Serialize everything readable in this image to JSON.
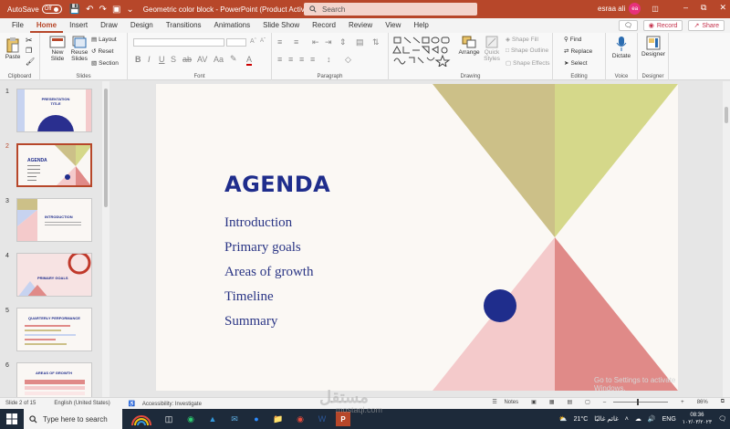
{
  "titlebar": {
    "autosave_label": "AutoSave",
    "autosave_state": "Off",
    "doc_title": "Geometric color block  -  PowerPoint (Product Activation Failed)",
    "search_placeholder": "Search",
    "user_name": "esraa ali",
    "user_initials": "ea"
  },
  "tabs": [
    "File",
    "Home",
    "Insert",
    "Draw",
    "Design",
    "Transitions",
    "Animations",
    "Slide Show",
    "Record",
    "Review",
    "View",
    "Help"
  ],
  "active_tab": "Home",
  "tab_actions": {
    "record": "Record",
    "share": "Share"
  },
  "ribbon": {
    "clipboard": {
      "paste": "Paste",
      "label": "Clipboard"
    },
    "slides": {
      "new_slide": "New Slide",
      "reuse": "Reuse Slides",
      "layout": "Layout",
      "reset": "Reset",
      "section": "Section",
      "label": "Slides"
    },
    "font": {
      "label": "Font"
    },
    "paragraph": {
      "label": "Paragraph"
    },
    "drawing": {
      "arrange": "Arrange",
      "quick_styles": "Quick Styles",
      "shape_fill": "Shape Fill",
      "shape_outline": "Shape Outline",
      "shape_effects": "Shape Effects",
      "label": "Drawing"
    },
    "editing": {
      "find": "Find",
      "replace": "Replace",
      "select": "Select",
      "label": "Editing"
    },
    "voice": {
      "dictate": "Dictate",
      "label": "Voice"
    },
    "designer": {
      "designer": "Designer",
      "label": "Designer"
    }
  },
  "thumbnails": [
    {
      "num": "1",
      "title": "PRESENTATION TITLE"
    },
    {
      "num": "2",
      "title": "AGENDA"
    },
    {
      "num": "3",
      "title": "INTRODUCTION"
    },
    {
      "num": "4",
      "title": "PRIMARY GOALS"
    },
    {
      "num": "5",
      "title": "QUARTERLY PERFORMANCE"
    },
    {
      "num": "6",
      "title": "AREAS OF GROWTH"
    }
  ],
  "slide": {
    "title": "AGENDA",
    "items": [
      "Introduction",
      "Primary goals",
      "Areas of growth",
      "Timeline",
      "Summary"
    ],
    "watermark": "Go to Settings to activate Windows.",
    "colors": {
      "olive": "#ccc088",
      "lime": "#d5d88a",
      "pink": "#f4cacb",
      "coral": "#e08a88",
      "navy": "#1f2d8c"
    }
  },
  "status": {
    "slide_info": "Slide 2 of 15",
    "language": "English (United States)",
    "accessibility": "Accessibility: Investigate",
    "notes": "Notes",
    "zoom": "86%"
  },
  "taskbar": {
    "search_placeholder": "Type here to search",
    "weather": "21°C",
    "weather_text": "غائم غالبًا",
    "lang": "ENG",
    "time": "08:36",
    "date": "١٠٢/٠٣/٢٠٢٣"
  },
  "watermark_logo": {
    "brand": "مستقل",
    "site": "mostaql.com"
  }
}
